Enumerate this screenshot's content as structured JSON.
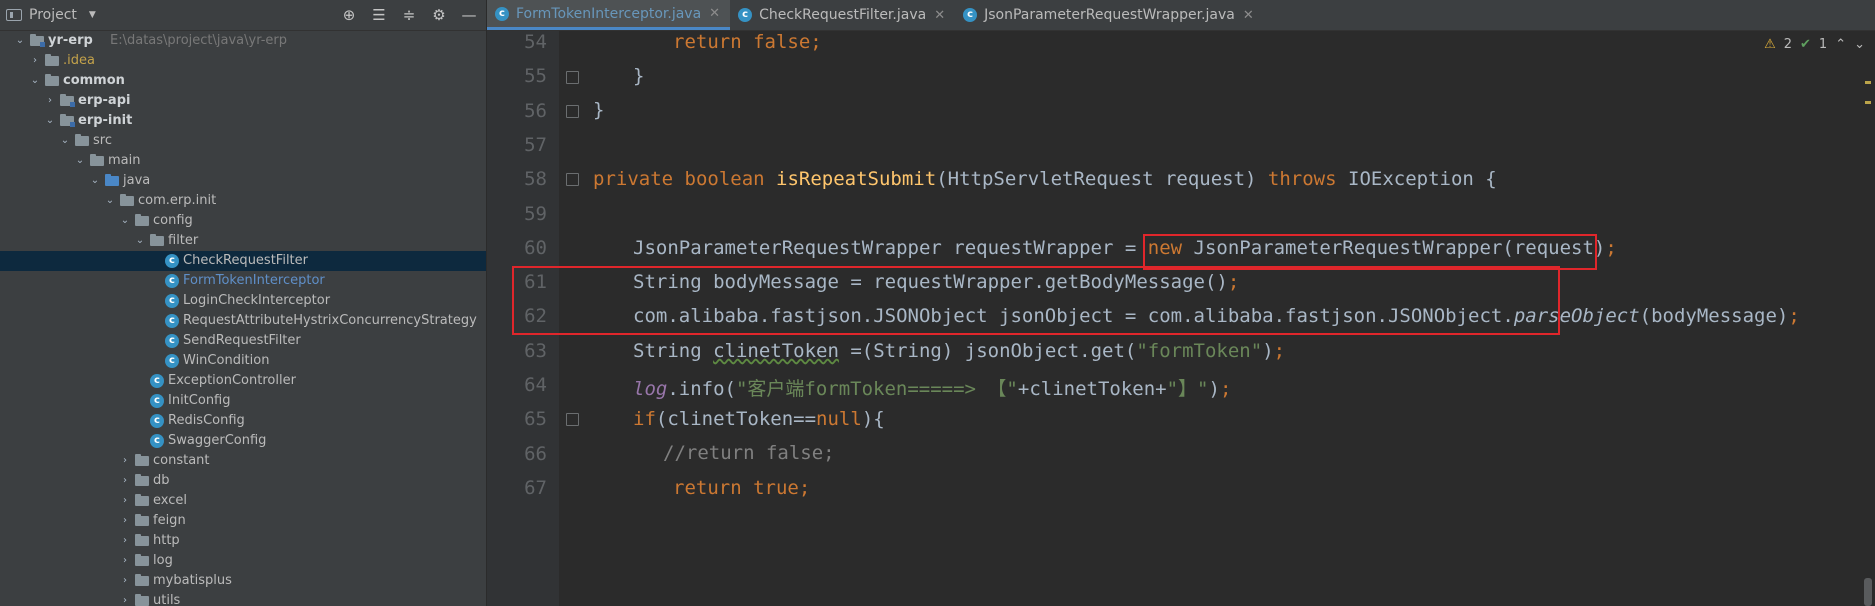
{
  "project_panel": {
    "title": "Project",
    "tools": [
      "target-icon",
      "expand-all-icon",
      "collapse-all-icon",
      "gear-icon",
      "hide-icon"
    ],
    "tree": [
      {
        "label": "yr-erp",
        "path": "E:\\datas\\project\\java\\yr-erp",
        "type": "module",
        "bold": true,
        "expanded": true
      },
      {
        "label": ".idea",
        "type": "folder",
        "color": "#c3a24b",
        "expanded": false
      },
      {
        "label": "common",
        "type": "folder",
        "bold": true,
        "expanded": true
      },
      {
        "label": "erp-api",
        "type": "module",
        "bold": true,
        "expanded": false
      },
      {
        "label": "erp-init",
        "type": "module",
        "bold": true,
        "expanded": true
      },
      {
        "label": "src",
        "type": "folder",
        "expanded": true
      },
      {
        "label": "main",
        "type": "folder",
        "expanded": true
      },
      {
        "label": "java",
        "type": "source-folder",
        "expanded": true
      },
      {
        "label": "com.erp.init",
        "type": "package",
        "expanded": true
      },
      {
        "label": "config",
        "type": "package",
        "expanded": true
      },
      {
        "label": "filter",
        "type": "package",
        "expanded": true
      },
      {
        "label": "CheckRequestFilter",
        "type": "class",
        "selected": true
      },
      {
        "label": "FormTokenInterceptor",
        "type": "class",
        "current": true
      },
      {
        "label": "LoginCheckInterceptor",
        "type": "class"
      },
      {
        "label": "RequestAttributeHystrixConcurrencyStrategy",
        "type": "class"
      },
      {
        "label": "SendRequestFilter",
        "type": "class"
      },
      {
        "label": "WinCondition",
        "type": "class"
      },
      {
        "label": "ExceptionController",
        "type": "class"
      },
      {
        "label": "InitConfig",
        "type": "class"
      },
      {
        "label": "RedisConfig",
        "type": "class"
      },
      {
        "label": "SwaggerConfig",
        "type": "class"
      },
      {
        "label": "constant",
        "type": "package",
        "expanded": false
      },
      {
        "label": "db",
        "type": "package",
        "expanded": false
      },
      {
        "label": "excel",
        "type": "package",
        "expanded": false
      },
      {
        "label": "feign",
        "type": "package",
        "expanded": false
      },
      {
        "label": "http",
        "type": "package",
        "expanded": false
      },
      {
        "label": "log",
        "type": "package",
        "expanded": false
      },
      {
        "label": "mybatisplus",
        "type": "package",
        "expanded": false
      },
      {
        "label": "utils",
        "type": "package",
        "expanded": false
      }
    ]
  },
  "tabs": [
    {
      "label": "FormTokenInterceptor.java",
      "active": true,
      "modified": true
    },
    {
      "label": "CheckRequestFilter.java",
      "active": false
    },
    {
      "label": "JsonParameterRequestWrapper.java",
      "active": false
    }
  ],
  "inspections": {
    "warnings": "2",
    "ok": "1"
  },
  "code_lines": [
    {
      "n": "54"
    },
    {
      "n": "55"
    },
    {
      "n": "56"
    },
    {
      "n": "57"
    },
    {
      "n": "58"
    },
    {
      "n": "59"
    },
    {
      "n": "60"
    },
    {
      "n": "61"
    },
    {
      "n": "62"
    },
    {
      "n": "63"
    },
    {
      "n": "64"
    },
    {
      "n": "65"
    },
    {
      "n": "66"
    },
    {
      "n": "67"
    }
  ],
  "code": {
    "l54": {
      "kw_return": "return ",
      "kw_false": "false",
      "semi": ";"
    },
    "l55": {
      "text": "}"
    },
    "l56": {
      "text": "}"
    },
    "l58": {
      "kw_private": "private ",
      "kw_boolean": "boolean ",
      "fn": "isRepeatSubmit",
      "params": "(HttpServletRequest request) ",
      "kw_throws": "throws ",
      "rest": "IOException {"
    },
    "l60": {
      "a": "JsonParameterRequestWrapper requestWrapper ",
      "b": "= ",
      "kw_new": "new ",
      "c": "JsonParameterRequestWrapper(request)",
      "semi": ";"
    },
    "l61": {
      "a": "String bodyMessage = requestWrapper.getBodyMessage()",
      "semi": ";"
    },
    "l62": {
      "a": "com.alibaba.fastjson.JSONObject jsonObject = com.alibaba.fastjson.JSONObject.",
      "it": "parseObject",
      "b": "(bodyMessage)",
      "semi": ";"
    },
    "l63": {
      "a": "String ",
      "sq": "clinetToken",
      "b": " =(String) jsonObject.get(",
      "str": "\"formToken\"",
      "c": ")",
      "semi": ";"
    },
    "l64": {
      "log": "log",
      "a": ".info(",
      "str1": "\"客户端formToken=====> 【\"",
      "b": "+clinetToken+",
      "str2": "\"】\"",
      "c": ")",
      "semi": ";"
    },
    "l65": {
      "kw_if": "if",
      "a": "(clinetToken==",
      "kw_null": "null",
      "b": "){"
    },
    "l66": {
      "cmt": "//return false;"
    },
    "l67": {
      "kw_return": "return ",
      "kw_true": "true",
      "semi": ";"
    }
  }
}
